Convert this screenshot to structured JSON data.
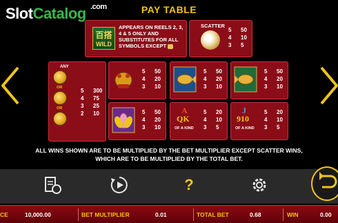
{
  "brand": {
    "word1": "Slot",
    "word2": "Catalog",
    "suffix": ".com"
  },
  "title": "PAY TABLE",
  "wild": {
    "chinese": "百搭",
    "label": "WILD",
    "description": "APPEARS ON REELS 2, 3, 4 & 5 ONLY AND SUBSTITUTES FOR ALL SYMBOLS EXCEPT"
  },
  "scatter": {
    "label": "SCATTER",
    "pays": [
      {
        "count": "5",
        "value": "50"
      },
      {
        "count": "4",
        "value": "10"
      },
      {
        "count": "3",
        "value": "5"
      }
    ]
  },
  "any": {
    "label": "ANY",
    "or_label": "OR",
    "pays": [
      {
        "count": "5",
        "value": "300"
      },
      {
        "count": "4",
        "value": "75"
      },
      {
        "count": "3",
        "value": "25"
      },
      {
        "count": "2",
        "value": "10"
      }
    ]
  },
  "symbols": {
    "toad": {
      "pays": [
        {
          "count": "5",
          "value": "50"
        },
        {
          "count": "4",
          "value": "20"
        },
        {
          "count": "3",
          "value": "10"
        }
      ]
    },
    "fish1": {
      "pays": [
        {
          "count": "5",
          "value": "50"
        },
        {
          "count": "4",
          "value": "20"
        },
        {
          "count": "3",
          "value": "10"
        }
      ]
    },
    "fish2": {
      "pays": [
        {
          "count": "5",
          "value": "50"
        },
        {
          "count": "4",
          "value": "20"
        },
        {
          "count": "3",
          "value": "10"
        }
      ]
    },
    "lotus": {
      "pays": [
        {
          "count": "5",
          "value": "50"
        },
        {
          "count": "4",
          "value": "20"
        },
        {
          "count": "3",
          "value": "10"
        }
      ]
    },
    "aqk": {
      "line1": "A",
      "line2": "QK",
      "of_kind": "OF A KIND",
      "pays": [
        {
          "count": "5",
          "value": "20"
        },
        {
          "count": "4",
          "value": "10"
        },
        {
          "count": "3",
          "value": "5"
        }
      ]
    },
    "jt9": {
      "line1": "J",
      "line2": "910",
      "of_kind": "OF A KIND",
      "pays": [
        {
          "count": "5",
          "value": "20"
        },
        {
          "count": "4",
          "value": "10"
        },
        {
          "count": "3",
          "value": "5"
        }
      ]
    }
  },
  "note_line1": "ALL WINS SHOWN ARE TO BE MULTIPLIED BY THE BET MULTIPLIER EXCEPT SCATTER WINS,",
  "note_line2": "WHICH ARE TO BE MULTIPLIED BY THE TOTAL BET.",
  "toolbar": {
    "icons": [
      "paytable-money-icon",
      "autoplay-icon",
      "help-icon",
      "settings-icon",
      "back-icon"
    ],
    "help_glyph": "?"
  },
  "status": {
    "balance_label": "CE",
    "balance_value": "10,000.00",
    "bet_mult_label": "BET MULTIPLIER",
    "bet_mult_value": "0.01",
    "total_bet_label": "TOTAL BET",
    "total_bet_value": "0.68",
    "win_label": "WIN",
    "win_value": "0.00"
  },
  "colors": {
    "accent": "#f0c419",
    "panel": "#8b0d18",
    "brand_green": "#39b54a"
  }
}
